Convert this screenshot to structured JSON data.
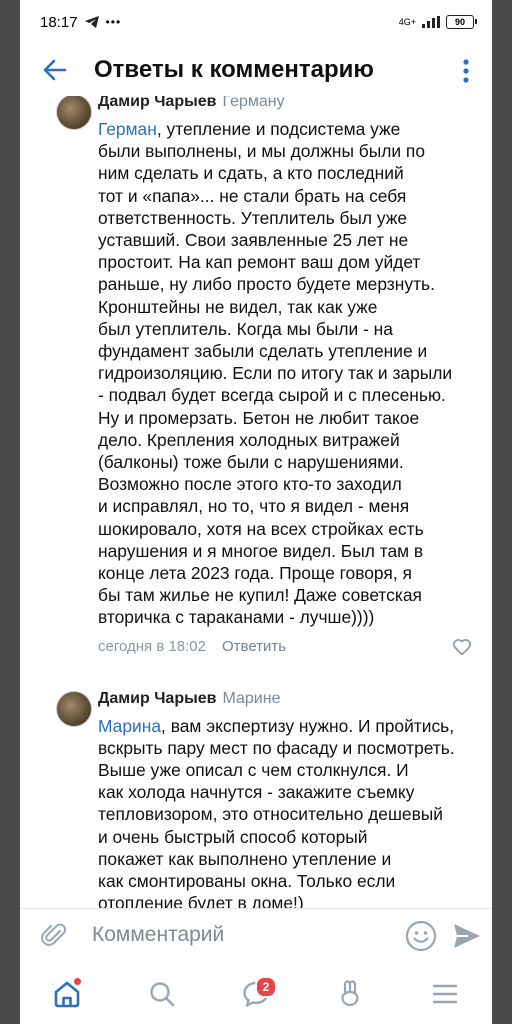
{
  "status_bar": {
    "time": "18:17",
    "network": "4G+",
    "battery": "90"
  },
  "header": {
    "title": "Ответы к комментарию"
  },
  "comments": [
    {
      "author": "Дамир Чарыев",
      "reply_to": "Герману",
      "mention": "Герман",
      "lines": [
        ", утепление и подсистема уже",
        "были выполнены, и мы должны были по",
        "ним сделать и сдать,  а кто последний",
        "тот и «папа»... не стали брать на себя",
        "ответственность. Утеплитель был уже",
        "уставший. Свои заявленные 25 лет не",
        "простоит. На кап ремонт ваш дом уйдет",
        "раньше, ну либо просто будете мерзнуть.",
        "Кронштейны не видел, так как уже",
        "был утеплитель.  Когда мы были - на",
        "фундамент забыли сделать утепление и",
        "гидроизоляцию. Если по итогу так и зарыли",
        "- подвал будет всегда сырой и с плесенью.",
        "Ну и промерзать. Бетон не любит такое",
        "дело. Крепления холодных витражей",
        "(балконы) тоже были с нарушениями.",
        "Возможно после этого кто-то заходил",
        "и исправлял, но то, что я видел - меня",
        "шокировало, хотя на всех стройках есть",
        "нарушения и я многое видел. Был там в",
        "конце лета 2023 года. Проще говоря, я",
        "бы там жилье не купил! Даже советская",
        "вторичка с тараканами - лучше))))"
      ],
      "timestamp": "сегодня в 18:02",
      "reply_label": "Ответить"
    },
    {
      "author": "Дамир Чарыев",
      "reply_to": "Марине",
      "mention": "Марина",
      "lines": [
        ", вам экспертизу нужно. И пройтись,",
        "вскрыть пару мест по фасаду и посмотреть.",
        "Выше уже описал с чем столкнулся. И",
        "как холода начнутся - закажите съемку",
        "тепловизором, это относительно дешевый",
        "и очень быстрый способ который",
        "покажет как выполнено утепление и",
        "как смонтированы окна. Только если",
        "отопление будет в доме!)"
      ]
    }
  ],
  "input": {
    "placeholder": "Комментарий"
  },
  "tabbar": {
    "messages_badge": "2"
  }
}
